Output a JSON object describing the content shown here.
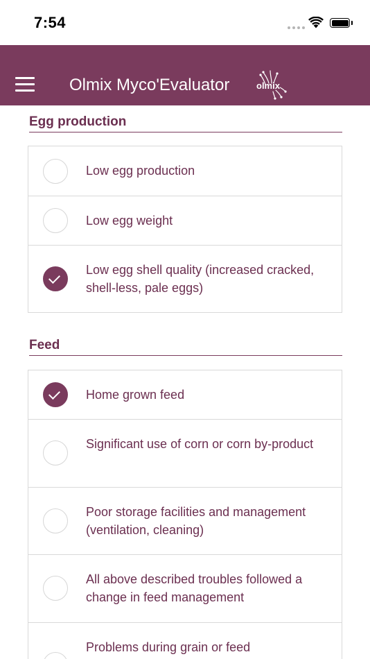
{
  "status_bar": {
    "time": "7:54"
  },
  "app_bar": {
    "title": "Olmix Myco'Evaluator",
    "logo_text": "olmix"
  },
  "sections": [
    {
      "title": "Egg production",
      "options": [
        {
          "label": "Low egg production",
          "checked": false
        },
        {
          "label": "Low egg weight",
          "checked": false
        },
        {
          "label": "Low egg shell quality (increased cracked, shell-less, pale eggs)",
          "checked": true
        }
      ]
    },
    {
      "title": "Feed",
      "options": [
        {
          "label": "Home grown feed",
          "checked": true
        },
        {
          "label": "Significant use of corn or corn by-product",
          "checked": false
        },
        {
          "label": "Poor storage facilities and management (ventilation, cleaning)",
          "checked": false
        },
        {
          "label": "All above described troubles followed a change in feed management",
          "checked": false
        },
        {
          "label": "Problems during grain or feed",
          "checked": false
        }
      ]
    }
  ],
  "colors": {
    "primary": "#7a3b5d",
    "text": "#6b2f50",
    "border": "#d9d9d9"
  }
}
